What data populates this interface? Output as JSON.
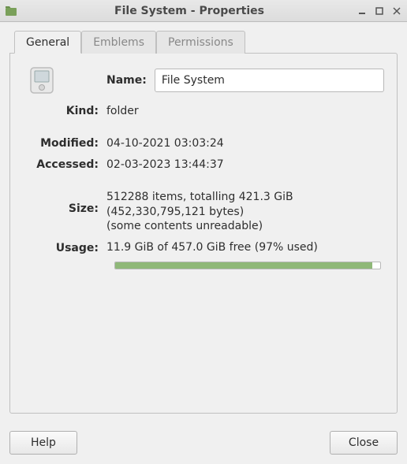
{
  "window": {
    "title": "File System - Properties"
  },
  "tabs": {
    "general": "General",
    "emblems": "Emblems",
    "permissions": "Permissions"
  },
  "labels": {
    "name": "Name:",
    "kind": "Kind:",
    "modified": "Modified:",
    "accessed": "Accessed:",
    "size": "Size:",
    "usage": "Usage:"
  },
  "values": {
    "name": "File System",
    "kind": "folder",
    "modified": "04-10-2021 03:03:24",
    "accessed": "02-03-2023 13:44:37",
    "size_items": "512288 items, totalling 421.3 GiB",
    "size_bytes": "(452,330,795,121 bytes)",
    "size_note": "(some contents unreadable)",
    "usage_text": "11.9 GiB of 457.0 GiB free (97% used)"
  },
  "usage_percent": 97,
  "buttons": {
    "help": "Help",
    "close": "Close"
  }
}
